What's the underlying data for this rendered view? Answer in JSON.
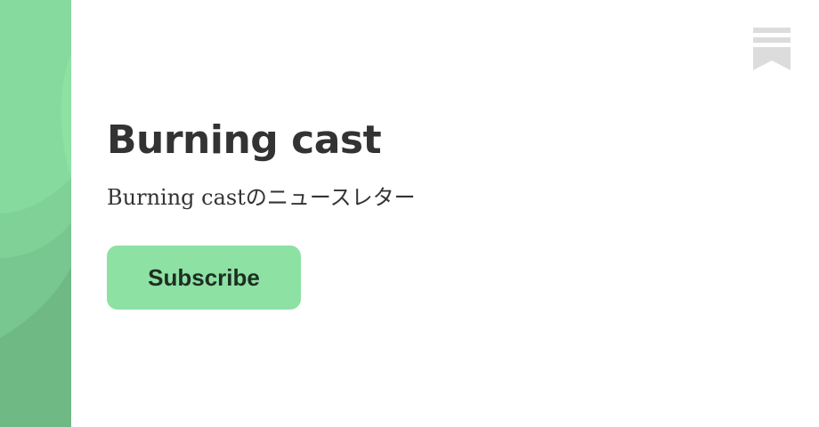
{
  "publication": {
    "title": "Burning cast",
    "subtitle": "Burning castのニュースレター"
  },
  "actions": {
    "subscribe_label": "Subscribe"
  },
  "brand": {
    "logo_icon": "substack-bookmark-icon",
    "logo_color": "#dcdcdc"
  },
  "colors": {
    "accent": "#8ce1a3",
    "side_art_light": "#8ce1a3",
    "side_art_mid": "#7fd198",
    "side_art_dark": "#6fb985",
    "text": "#333333"
  }
}
